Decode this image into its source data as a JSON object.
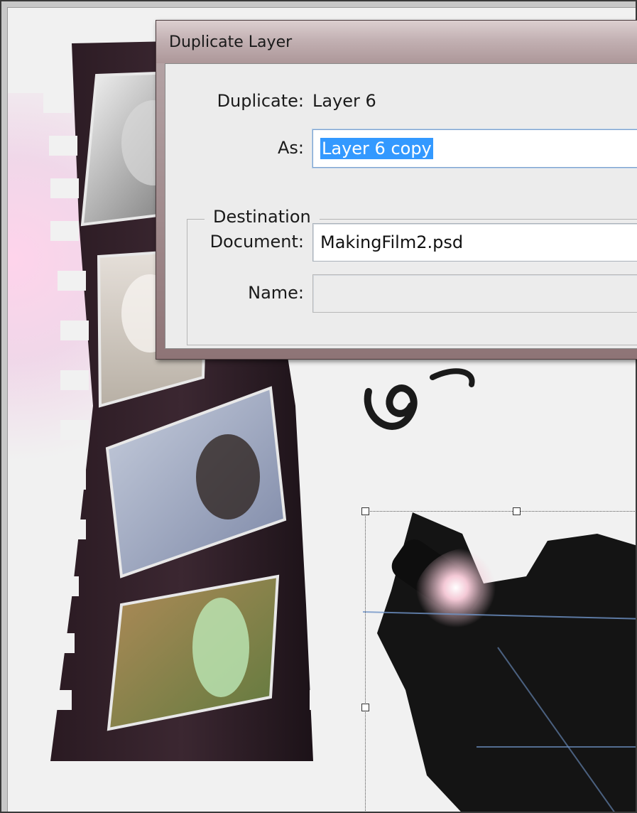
{
  "dialog": {
    "title": "Duplicate Layer",
    "duplicate_label": "Duplicate:",
    "duplicate_value": "Layer 6",
    "as_label": "As:",
    "as_value": "Layer 6 copy",
    "destination_legend": "Destination",
    "document_label": "Document:",
    "document_value": "MakingFilm2.psd",
    "name_label": "Name:",
    "name_value": ""
  },
  "colors": {
    "selection": "#3399ff",
    "titlebar": "#c3b1b3",
    "dialog_body": "#ececec"
  }
}
